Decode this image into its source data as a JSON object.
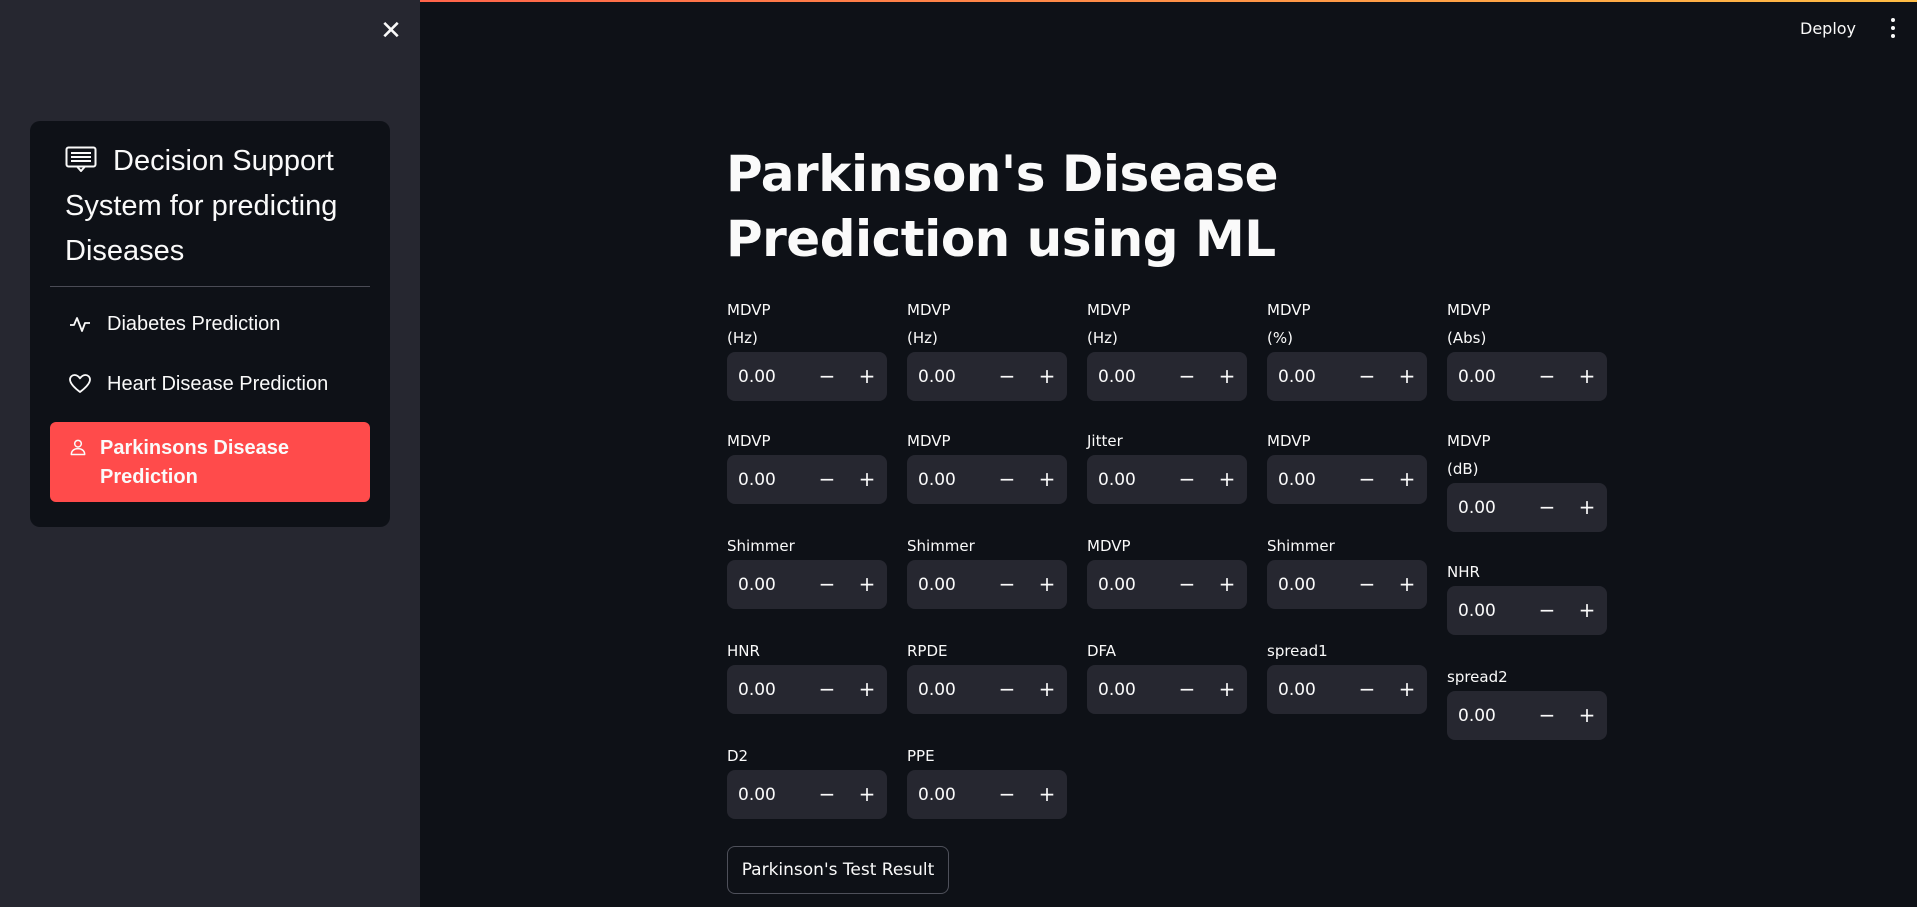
{
  "header": {
    "deploy_label": "Deploy"
  },
  "sidebar": {
    "title": "Decision Support System for predicting Diseases",
    "items": [
      {
        "label": "Diabetes Prediction",
        "icon": "activity-icon"
      },
      {
        "label": "Heart Disease Prediction",
        "icon": "heart-icon"
      },
      {
        "label": "Parkinsons Disease Prediction",
        "icon": "person-icon",
        "active": true
      }
    ],
    "active_color": "#ff4b4b"
  },
  "main": {
    "title": "Parkinson's Disease Prediction using ML",
    "fields": [
      {
        "label": "MDVP\n(Hz)",
        "value": "0.00"
      },
      {
        "label": "MDVP\n(Hz)",
        "value": "0.00"
      },
      {
        "label": "MDVP\n(Hz)",
        "value": "0.00"
      },
      {
        "label": "MDVP\n(%)",
        "value": "0.00"
      },
      {
        "label": "MDVP\n(Abs)",
        "value": "0.00"
      },
      {
        "label": "MDVP",
        "value": "0.00"
      },
      {
        "label": "MDVP",
        "value": "0.00"
      },
      {
        "label": "Jitter",
        "value": "0.00"
      },
      {
        "label": "MDVP",
        "value": "0.00"
      },
      {
        "label": "MDVP\n(dB)",
        "value": "0.00"
      },
      {
        "label": "Shimmer",
        "value": "0.00"
      },
      {
        "label": "Shimmer",
        "value": "0.00"
      },
      {
        "label": "MDVP",
        "value": "0.00"
      },
      {
        "label": "Shimmer",
        "value": "0.00"
      },
      {
        "label": "NHR",
        "value": "0.00"
      },
      {
        "label": "HNR",
        "value": "0.00"
      },
      {
        "label": "RPDE",
        "value": "0.00"
      },
      {
        "label": "DFA",
        "value": "0.00"
      },
      {
        "label": "spread1",
        "value": "0.00"
      },
      {
        "label": "spread2",
        "value": "0.00"
      },
      {
        "label": "D2",
        "value": "0.00"
      },
      {
        "label": "PPE",
        "value": "0.00"
      }
    ],
    "stepper": {
      "minus": "−",
      "plus": "+"
    },
    "result_button": "Parkinson's Test Result"
  }
}
